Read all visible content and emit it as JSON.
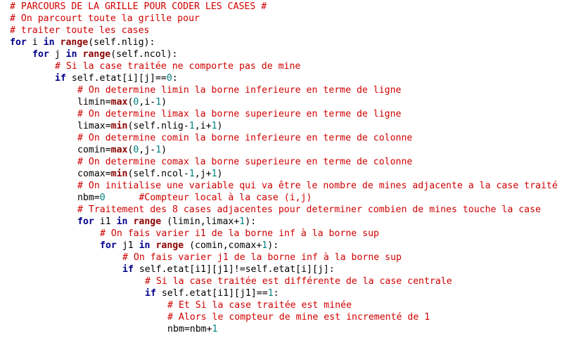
{
  "colors": {
    "background": "#ffffff",
    "keyword": "#00008b",
    "builtin": "#8b0000",
    "comment": "#d00000",
    "number": "#008080",
    "text": "#000000"
  },
  "editor": {
    "lines": [
      {
        "indent": 0,
        "tokens": [
          {
            "t": "cm",
            "v": "# PARCOURS DE LA GRILLE POUR CODER LES CASES #"
          }
        ]
      },
      {
        "indent": 0,
        "tokens": [
          {
            "t": "cm",
            "v": "# On parcourt toute la grille pour"
          }
        ]
      },
      {
        "indent": 0,
        "tokens": [
          {
            "t": "cm",
            "v": "# traiter toute les cases"
          }
        ]
      },
      {
        "indent": 0,
        "tokens": [
          {
            "t": "kw",
            "v": "for"
          },
          {
            "t": "tx",
            "v": " i "
          },
          {
            "t": "kw",
            "v": "in"
          },
          {
            "t": "tx",
            "v": " "
          },
          {
            "t": "bi",
            "v": "range"
          },
          {
            "t": "tx",
            "v": "(self.nlig):"
          }
        ]
      },
      {
        "indent": 1,
        "tokens": [
          {
            "t": "kw",
            "v": "for"
          },
          {
            "t": "tx",
            "v": " j "
          },
          {
            "t": "kw",
            "v": "in"
          },
          {
            "t": "tx",
            "v": " "
          },
          {
            "t": "bi",
            "v": "range"
          },
          {
            "t": "tx",
            "v": "(self.ncol):"
          }
        ]
      },
      {
        "indent": 2,
        "tokens": [
          {
            "t": "cm",
            "v": "# Si la case traitée ne comporte pas de mine"
          }
        ]
      },
      {
        "indent": 2,
        "tokens": [
          {
            "t": "kw",
            "v": "if"
          },
          {
            "t": "tx",
            "v": " self.etat[i][j]=="
          },
          {
            "t": "num",
            "v": "0"
          },
          {
            "t": "tx",
            "v": ":"
          }
        ]
      },
      {
        "indent": 3,
        "tokens": [
          {
            "t": "cm",
            "v": "# On determine limin la borne inferieure en terme de ligne"
          }
        ]
      },
      {
        "indent": 3,
        "tokens": [
          {
            "t": "tx",
            "v": "limin="
          },
          {
            "t": "bi",
            "v": "max"
          },
          {
            "t": "tx",
            "v": "("
          },
          {
            "t": "num",
            "v": "0"
          },
          {
            "t": "tx",
            "v": ",i-"
          },
          {
            "t": "num",
            "v": "1"
          },
          {
            "t": "tx",
            "v": ")"
          }
        ]
      },
      {
        "indent": 3,
        "tokens": [
          {
            "t": "cm",
            "v": "# On determine limax la borne superieure en terme de ligne"
          }
        ]
      },
      {
        "indent": 3,
        "tokens": [
          {
            "t": "tx",
            "v": "limax="
          },
          {
            "t": "bi",
            "v": "min"
          },
          {
            "t": "tx",
            "v": "(self.nlig-"
          },
          {
            "t": "num",
            "v": "1"
          },
          {
            "t": "tx",
            "v": ",i+"
          },
          {
            "t": "num",
            "v": "1"
          },
          {
            "t": "tx",
            "v": ")"
          }
        ]
      },
      {
        "indent": 3,
        "tokens": [
          {
            "t": "cm",
            "v": "# On determine comin la borne inferieure en terme de colonne"
          }
        ]
      },
      {
        "indent": 3,
        "tokens": [
          {
            "t": "tx",
            "v": "comin="
          },
          {
            "t": "bi",
            "v": "max"
          },
          {
            "t": "tx",
            "v": "("
          },
          {
            "t": "num",
            "v": "0"
          },
          {
            "t": "tx",
            "v": ",j-"
          },
          {
            "t": "num",
            "v": "1"
          },
          {
            "t": "tx",
            "v": ")"
          }
        ]
      },
      {
        "indent": 3,
        "tokens": [
          {
            "t": "cm",
            "v": "# On determine comax la borne superieure en terme de colonne"
          }
        ]
      },
      {
        "indent": 3,
        "tokens": [
          {
            "t": "tx",
            "v": "comax="
          },
          {
            "t": "bi",
            "v": "min"
          },
          {
            "t": "tx",
            "v": "(self.ncol-"
          },
          {
            "t": "num",
            "v": "1"
          },
          {
            "t": "tx",
            "v": ",j+"
          },
          {
            "t": "num",
            "v": "1"
          },
          {
            "t": "tx",
            "v": ")"
          }
        ]
      },
      {
        "indent": 3,
        "tokens": [
          {
            "t": "cm",
            "v": "# On initialise une variable qui va être le nombre de mines adjacente a la case traité"
          }
        ]
      },
      {
        "indent": 3,
        "tokens": [
          {
            "t": "tx",
            "v": "nbm="
          },
          {
            "t": "num",
            "v": "0"
          },
          {
            "t": "tx",
            "v": "      "
          },
          {
            "t": "cm",
            "v": "#Compteur local à la case (i,j)"
          }
        ]
      },
      {
        "indent": 3,
        "tokens": [
          {
            "t": "cm",
            "v": "# Traitement des 8 cases adjacentes pour determiner combien de mines touche la case"
          }
        ]
      },
      {
        "indent": 3,
        "tokens": [
          {
            "t": "kw",
            "v": "for"
          },
          {
            "t": "tx",
            "v": " i1 "
          },
          {
            "t": "kw",
            "v": "in"
          },
          {
            "t": "tx",
            "v": " "
          },
          {
            "t": "bi",
            "v": "range"
          },
          {
            "t": "tx",
            "v": " (limin,limax+"
          },
          {
            "t": "num",
            "v": "1"
          },
          {
            "t": "tx",
            "v": "):"
          }
        ]
      },
      {
        "indent": 4,
        "tokens": [
          {
            "t": "cm",
            "v": "# On fais varier i1 de la borne inf à la borne sup"
          }
        ]
      },
      {
        "indent": 4,
        "tokens": [
          {
            "t": "kw",
            "v": "for"
          },
          {
            "t": "tx",
            "v": " j1 "
          },
          {
            "t": "kw",
            "v": "in"
          },
          {
            "t": "tx",
            "v": " "
          },
          {
            "t": "bi",
            "v": "range"
          },
          {
            "t": "tx",
            "v": " (comin,comax+"
          },
          {
            "t": "num",
            "v": "1"
          },
          {
            "t": "tx",
            "v": "):"
          }
        ]
      },
      {
        "indent": 5,
        "tokens": [
          {
            "t": "cm",
            "v": "# On fais varier j1 de la borne inf à la borne sup"
          }
        ]
      },
      {
        "indent": 5,
        "tokens": [
          {
            "t": "kw",
            "v": "if"
          },
          {
            "t": "tx",
            "v": " self.etat[i1][j1]!=self.etat[i][j]:"
          }
        ]
      },
      {
        "indent": 6,
        "tokens": [
          {
            "t": "cm",
            "v": "# Si la case traitée est différente de la case centrale"
          }
        ]
      },
      {
        "indent": 6,
        "tokens": [
          {
            "t": "kw",
            "v": "if"
          },
          {
            "t": "tx",
            "v": " self.etat[i1][j1]=="
          },
          {
            "t": "num",
            "v": "1"
          },
          {
            "t": "tx",
            "v": ":"
          }
        ]
      },
      {
        "indent": 7,
        "tokens": [
          {
            "t": "cm",
            "v": "# Et Si la case traitée est minée"
          }
        ]
      },
      {
        "indent": 7,
        "tokens": [
          {
            "t": "cm",
            "v": "# Alors le compteur de mine est incrementé de 1"
          }
        ]
      },
      {
        "indent": 7,
        "tokens": [
          {
            "t": "tx",
            "v": "nbm=nbm+"
          },
          {
            "t": "num",
            "v": "1"
          }
        ]
      }
    ]
  }
}
